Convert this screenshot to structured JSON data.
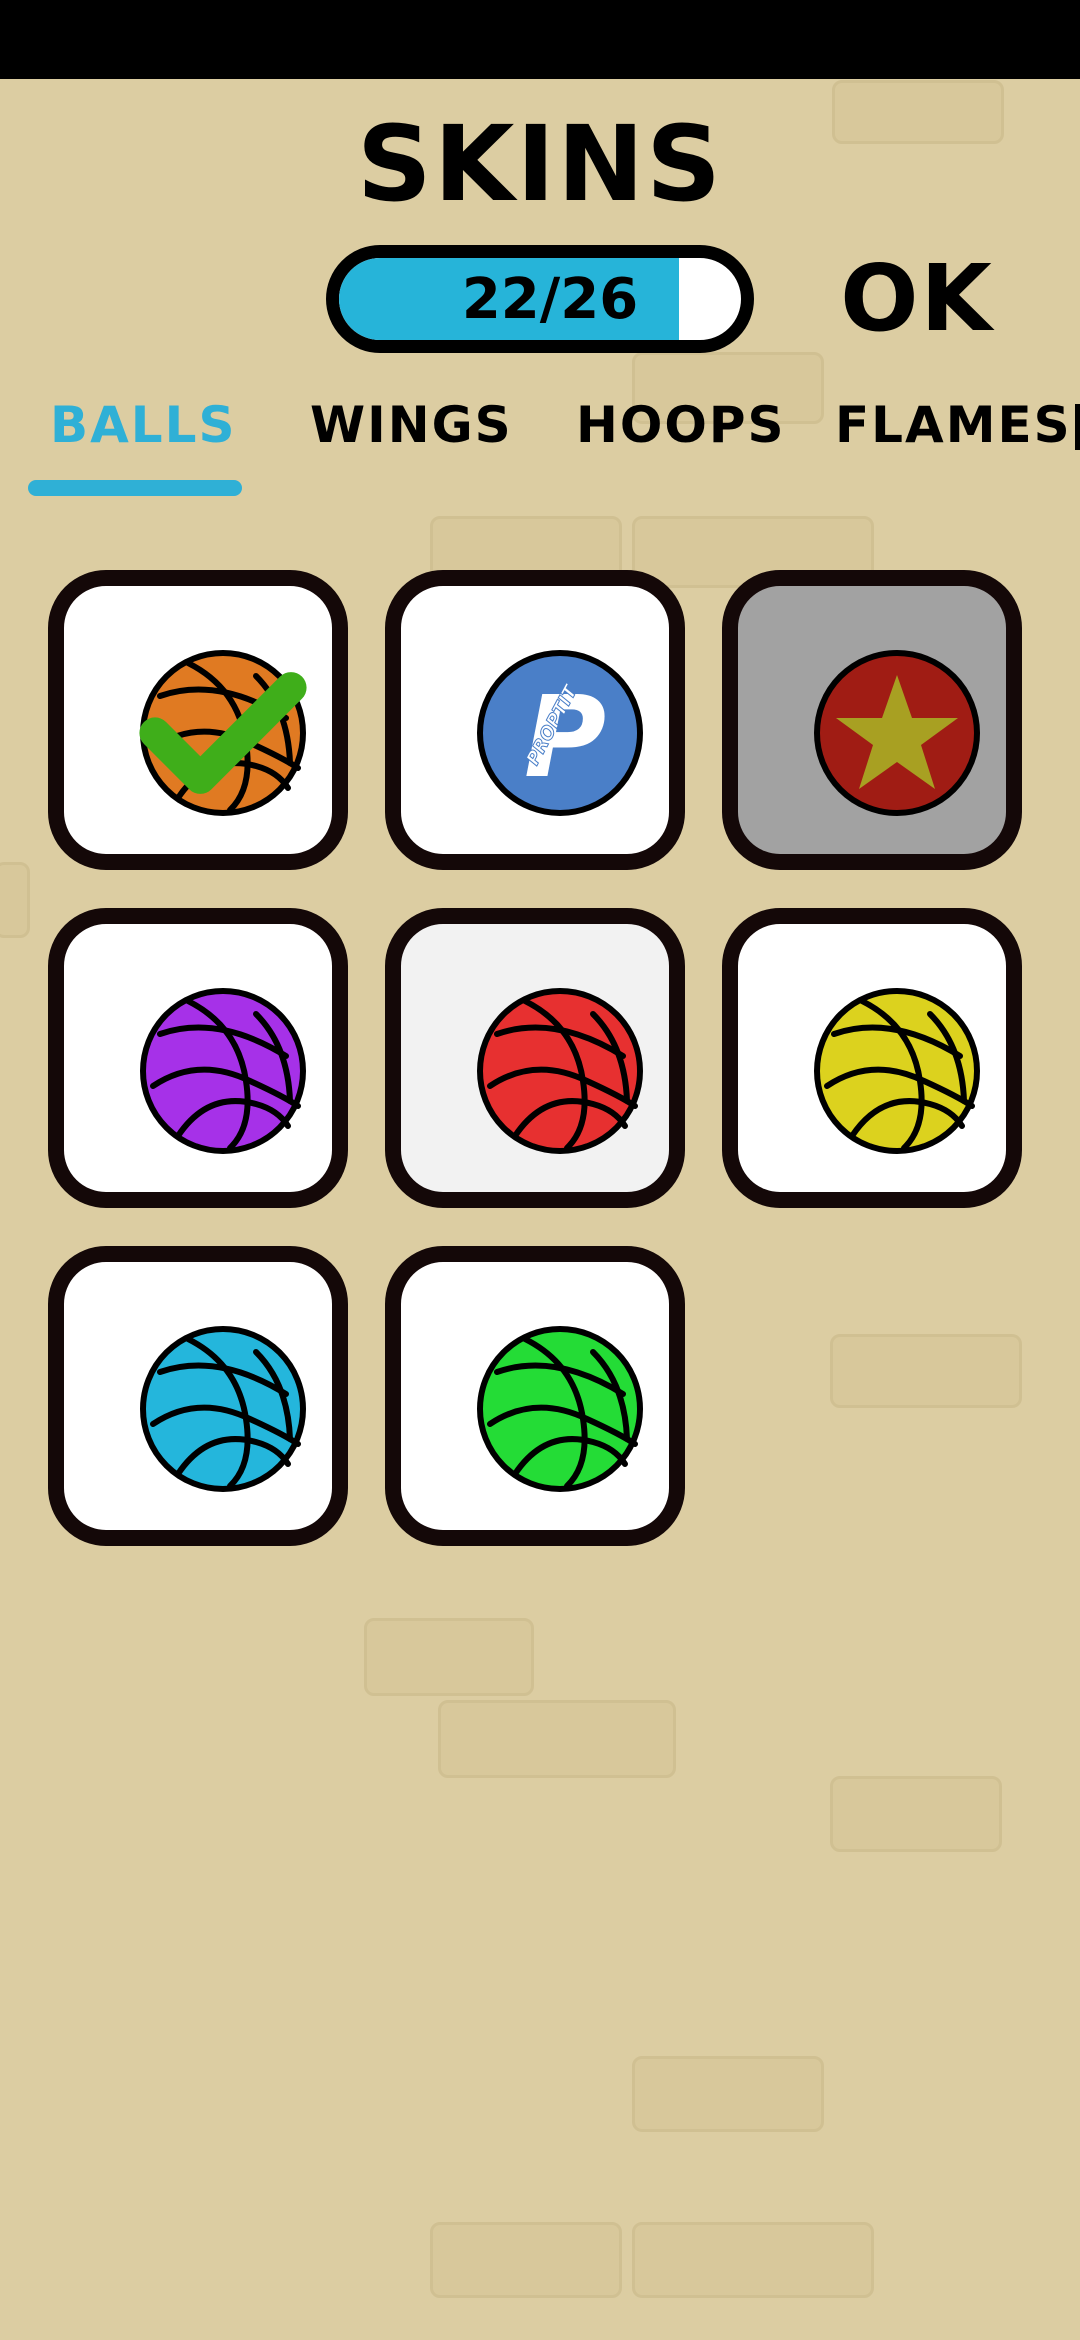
{
  "header": {
    "title": "SKINS",
    "progress_label": "22/26",
    "progress_fraction": 0.846,
    "ok_label": "OK"
  },
  "tabs": [
    {
      "label": "BALLS",
      "active": true
    },
    {
      "label": "WINGS",
      "active": false
    },
    {
      "label": "HOOPS",
      "active": false
    },
    {
      "label": "FLAMES",
      "active": false
    }
  ],
  "colors": {
    "background": "#dccda2",
    "accent": "#2fb0d6",
    "progress_fill": "#26b4d9",
    "locked_tile": "#a2a2a2",
    "equipped_check": "#3fae1a"
  },
  "skins": [
    {
      "name": "orange-ball",
      "type": "basketball",
      "color": "#e07a22",
      "state": "equipped"
    },
    {
      "name": "proptit-ball",
      "type": "logo",
      "color": "#4a7fc8",
      "logo_text": "PROPTIT",
      "logo_letter": "P",
      "state": "unlocked"
    },
    {
      "name": "star-ball",
      "type": "star",
      "color": "#a01c14",
      "star_color": "#a8a022",
      "state": "locked"
    },
    {
      "name": "purple-ball",
      "type": "basketball",
      "color": "#a631e8",
      "state": "unlocked"
    },
    {
      "name": "red-ball",
      "type": "basketball",
      "color": "#e73030",
      "state": "pressed"
    },
    {
      "name": "yellow-ball",
      "type": "basketball",
      "color": "#dcd21e",
      "state": "unlocked"
    },
    {
      "name": "cyan-ball",
      "type": "basketball",
      "color": "#24b6dc",
      "state": "unlocked"
    },
    {
      "name": "green-ball",
      "type": "basketball",
      "color": "#24dc36",
      "state": "unlocked"
    }
  ]
}
